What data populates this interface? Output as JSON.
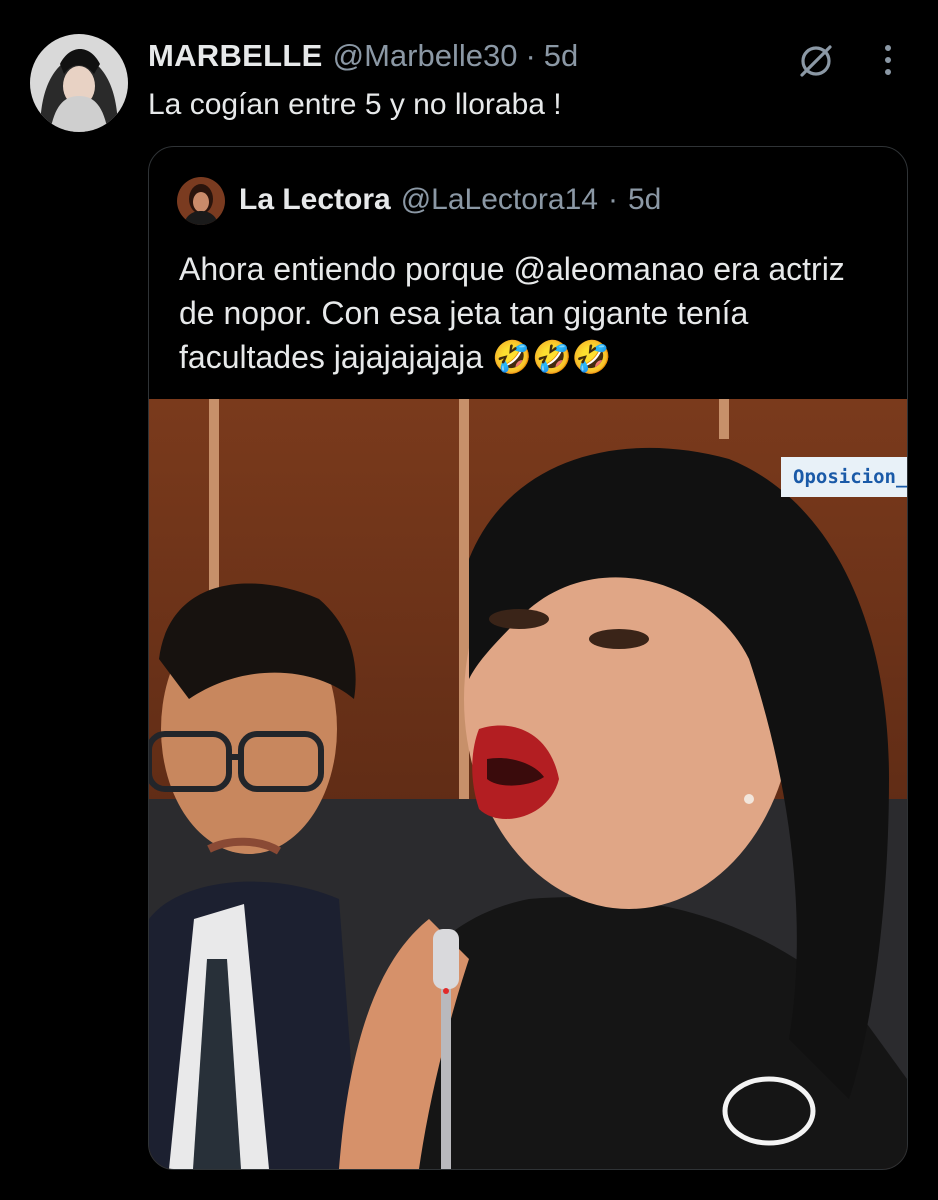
{
  "tweet": {
    "author_name": "MARBELLE",
    "author_handle": "@Marbelle30",
    "separator": "·",
    "time": "5d",
    "text": "La cogían entre 5 y no lloraba !",
    "icons": {
      "grok": "grok-icon",
      "more": "more-vertical-icon",
      "avatar": "avatar"
    }
  },
  "quote": {
    "author_name": "La Lectora",
    "author_handle": "@LaLectora14",
    "separator": "·",
    "time": "5d",
    "text": "Ahora entiendo porque @aleomanao era actriz de nopor. Con esa jeta tan gigante tenía facultades jajajajajaja 🤣🤣🤣",
    "media": {
      "watermark": "Oposicion_c"
    }
  },
  "colors": {
    "background": "#000000",
    "text_primary": "#e7e9ea",
    "text_secondary": "#8b98a5",
    "border": "#2f3336"
  }
}
